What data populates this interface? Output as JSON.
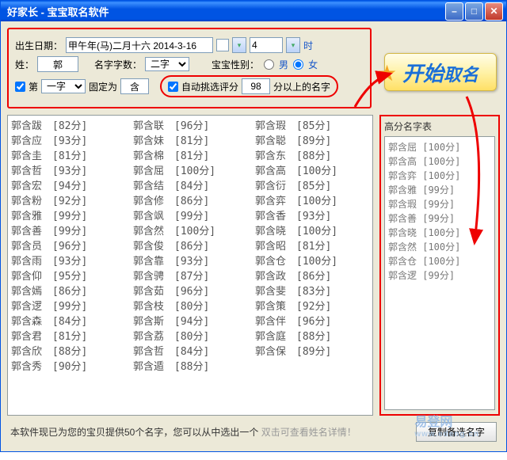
{
  "window": {
    "title": "好家长 - 宝宝取名软件"
  },
  "form": {
    "birth_label": "出生日期：",
    "birth_value": "甲午年(马)二月十六 2014-3-16",
    "hour_value": "4",
    "hour_suffix": "时",
    "surname_label": "姓：",
    "surname_value": "郭",
    "chars_label": "名字字数：",
    "chars_value": "二字",
    "gender_label": "宝宝性别：",
    "gender_male": "男",
    "gender_female": "女",
    "pos_prefix": "第",
    "pos_value": "一字",
    "fix_label": "固定为",
    "fix_value": "含",
    "auto_label": "自动挑选评分",
    "auto_value": "98",
    "auto_suffix": "分以上的名字"
  },
  "start_button": {
    "big": "开始",
    "small": "取名"
  },
  "names": [
    {
      "n": "郭含跋",
      "s": 82
    },
    {
      "n": "郭含应",
      "s": 93
    },
    {
      "n": "郭含圭",
      "s": 81
    },
    {
      "n": "郭含哲",
      "s": 93
    },
    {
      "n": "郭含宏",
      "s": 94
    },
    {
      "n": "郭含粉",
      "s": 92
    },
    {
      "n": "郭含雅",
      "s": 99
    },
    {
      "n": "郭含善",
      "s": 99
    },
    {
      "n": "郭含员",
      "s": 96
    },
    {
      "n": "郭含雨",
      "s": 93
    },
    {
      "n": "郭含仰",
      "s": 95
    },
    {
      "n": "郭含嫣",
      "s": 86
    },
    {
      "n": "郭含逻",
      "s": 99
    },
    {
      "n": "郭含森",
      "s": 84
    },
    {
      "n": "郭含君",
      "s": 81
    },
    {
      "n": "郭含欣",
      "s": 88
    },
    {
      "n": "郭含秀",
      "s": 90
    },
    {
      "n": "郭含联",
      "s": 96
    },
    {
      "n": "郭含妹",
      "s": 81
    },
    {
      "n": "郭含棉",
      "s": 81
    },
    {
      "n": "郭含屈",
      "s": 100
    },
    {
      "n": "郭含结",
      "s": 84
    },
    {
      "n": "郭含修",
      "s": 86
    },
    {
      "n": "郭含飒",
      "s": 99
    },
    {
      "n": "郭含然",
      "s": 100
    },
    {
      "n": "郭含俊",
      "s": 86
    },
    {
      "n": "郭含靠",
      "s": 93
    },
    {
      "n": "郭含骋",
      "s": 87
    },
    {
      "n": "郭含茹",
      "s": 96
    },
    {
      "n": "郭含枝",
      "s": 80
    },
    {
      "n": "郭含斯",
      "s": 94
    },
    {
      "n": "郭含荔",
      "s": 80
    },
    {
      "n": "郭含哲",
      "s": 84
    },
    {
      "n": "郭含遁",
      "s": 88
    },
    {
      "n": "郭含瑕",
      "s": 85
    },
    {
      "n": "郭含聪",
      "s": 89
    },
    {
      "n": "郭含东",
      "s": 88
    },
    {
      "n": "郭含高",
      "s": 100
    },
    {
      "n": "郭含衍",
      "s": 85
    },
    {
      "n": "郭含弈",
      "s": 100
    },
    {
      "n": "郭含香",
      "s": 93
    },
    {
      "n": "郭含晓",
      "s": 100
    },
    {
      "n": "郭含昭",
      "s": 81
    },
    {
      "n": "郭含仓",
      "s": 100
    },
    {
      "n": "郭含政",
      "s": 86
    },
    {
      "n": "郭含斐",
      "s": 83
    },
    {
      "n": "郭含策",
      "s": 92
    },
    {
      "n": "郭含伴",
      "s": 96
    },
    {
      "n": "郭含庭",
      "s": 88
    },
    {
      "n": "郭含保",
      "s": 89
    }
  ],
  "side": {
    "title": "高分名字表",
    "items": [
      {
        "n": "郭含屈",
        "s": 100
      },
      {
        "n": "郭含高",
        "s": 100
      },
      {
        "n": "郭含弈",
        "s": 100
      },
      {
        "n": "郭含雅",
        "s": 99
      },
      {
        "n": "郭含瑕",
        "s": 99
      },
      {
        "n": "郭含善",
        "s": 99
      },
      {
        "n": "郭含晓",
        "s": 100
      },
      {
        "n": "郭含然",
        "s": 100
      },
      {
        "n": "郭含仓",
        "s": 100
      },
      {
        "n": "郭含逻",
        "s": 99
      }
    ]
  },
  "status": {
    "msg": "本软件现已为您的宝贝提供50个名字，您可以从中选出一个",
    "hint": "双击可查看姓名详情！",
    "copy": "复制备选名字"
  },
  "watermark": {
    "line1": "易登网",
    "line2": "www.edeng.cn"
  }
}
